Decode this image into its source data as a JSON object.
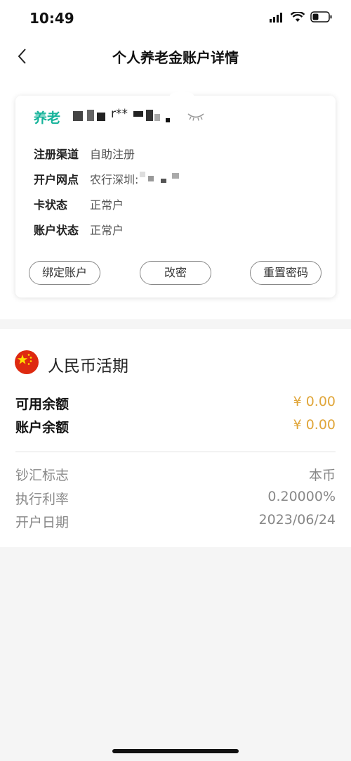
{
  "status_bar": {
    "time": "10:49"
  },
  "nav": {
    "title": "个人养老金账户详情"
  },
  "card": {
    "account_label": "养老",
    "account_number_masked": "r**",
    "rows": [
      {
        "label": "注册渠道",
        "value": "自助注册"
      },
      {
        "label": "开户网点",
        "value": "农行深圳:"
      },
      {
        "label": "卡状态",
        "value": "正常户"
      },
      {
        "label": "账户状态",
        "value": "正常户"
      }
    ],
    "buttons": {
      "bind": "绑定账户",
      "change_pwd": "改密",
      "reset_pwd": "重置密码"
    }
  },
  "currency_section": {
    "title": "人民币活期",
    "balances": [
      {
        "label": "可用余额",
        "value": "¥ 0.00"
      },
      {
        "label": "账户余额",
        "value": "¥ 0.00"
      }
    ],
    "meta": [
      {
        "label": "钞汇标志",
        "value": "本币"
      },
      {
        "label": "执行利率",
        "value": "0.20000%"
      },
      {
        "label": "开户日期",
        "value": "2023/06/24"
      }
    ]
  },
  "colors": {
    "accent": "#16b39a",
    "amount": "#e0a63a",
    "flag": "#de2910"
  },
  "icons": [
    "signal-icon",
    "wifi-icon",
    "battery-icon",
    "back-arrow-icon",
    "eye-closed-icon",
    "china-flag-icon"
  ]
}
